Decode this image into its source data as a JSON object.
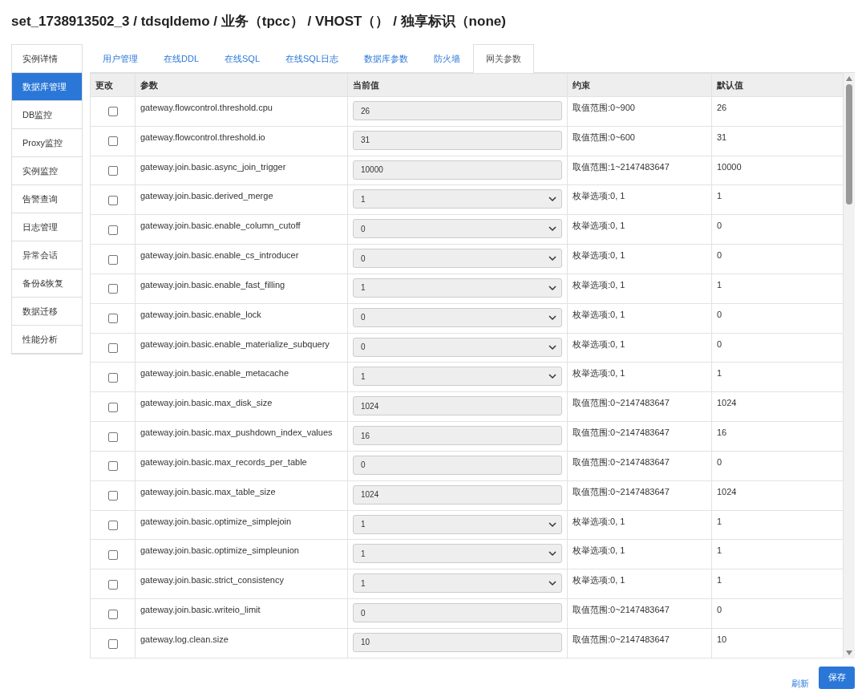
{
  "title": "set_1738913502_3 / tdsqldemo / 业务（tpcc） / VHOST（） / 独享标识（none)",
  "sidebar": [
    {
      "label": "实例详情",
      "selected": false
    },
    {
      "label": "数据库管理",
      "selected": true
    },
    {
      "label": "DB监控",
      "selected": false
    },
    {
      "label": "Proxy监控",
      "selected": false
    },
    {
      "label": "实例监控",
      "selected": false
    },
    {
      "label": "告警查询",
      "selected": false
    },
    {
      "label": "日志管理",
      "selected": false
    },
    {
      "label": "异常会话",
      "selected": false
    },
    {
      "label": "备份&恢复",
      "selected": false
    },
    {
      "label": "数据迁移",
      "selected": false
    },
    {
      "label": "性能分析",
      "selected": false
    }
  ],
  "tabs": [
    {
      "label": "用户管理",
      "selected": false
    },
    {
      "label": "在线DDL",
      "selected": false
    },
    {
      "label": "在线SQL",
      "selected": false
    },
    {
      "label": "在线SQL日志",
      "selected": false
    },
    {
      "label": "数据库参数",
      "selected": false
    },
    {
      "label": "防火墙",
      "selected": false
    },
    {
      "label": "网关参数",
      "selected": true
    }
  ],
  "table": {
    "columns": [
      "更改",
      "参数",
      "当前值",
      "约束",
      "默认值"
    ],
    "rows": [
      {
        "checked": false,
        "param": "gateway.flowcontrol.threshold.cpu",
        "kind": "input",
        "value": "26",
        "constraint": "取值范围:0~900",
        "default": "26"
      },
      {
        "checked": false,
        "param": "gateway.flowcontrol.threshold.io",
        "kind": "input",
        "value": "31",
        "constraint": "取值范围:0~600",
        "default": "31"
      },
      {
        "checked": false,
        "param": "gateway.join.basic.async_join_trigger",
        "kind": "input",
        "value": "10000",
        "constraint": "取值范围:1~2147483647",
        "default": "10000"
      },
      {
        "checked": false,
        "param": "gateway.join.basic.derived_merge",
        "kind": "select",
        "value": "1",
        "constraint": "枚举选项:0, 1",
        "default": "1"
      },
      {
        "checked": false,
        "param": "gateway.join.basic.enable_column_cutoff",
        "kind": "select",
        "value": "0",
        "constraint": "枚举选项:0, 1",
        "default": "0"
      },
      {
        "checked": false,
        "param": "gateway.join.basic.enable_cs_introducer",
        "kind": "select",
        "value": "0",
        "constraint": "枚举选项:0, 1",
        "default": "0"
      },
      {
        "checked": false,
        "param": "gateway.join.basic.enable_fast_filling",
        "kind": "select",
        "value": "1",
        "constraint": "枚举选项:0, 1",
        "default": "1"
      },
      {
        "checked": false,
        "param": "gateway.join.basic.enable_lock",
        "kind": "select",
        "value": "0",
        "constraint": "枚举选项:0, 1",
        "default": "0"
      },
      {
        "checked": false,
        "param": "gateway.join.basic.enable_materialize_subquery",
        "kind": "select",
        "value": "0",
        "constraint": "枚举选项:0, 1",
        "default": "0"
      },
      {
        "checked": false,
        "param": "gateway.join.basic.enable_metacache",
        "kind": "select",
        "value": "1",
        "constraint": "枚举选项:0, 1",
        "default": "1"
      },
      {
        "checked": false,
        "param": "gateway.join.basic.max_disk_size",
        "kind": "input",
        "value": "1024",
        "constraint": "取值范围:0~2147483647",
        "default": "1024"
      },
      {
        "checked": false,
        "param": "gateway.join.basic.max_pushdown_index_values",
        "kind": "input",
        "value": "16",
        "constraint": "取值范围:0~2147483647",
        "default": "16"
      },
      {
        "checked": false,
        "param": "gateway.join.basic.max_records_per_table",
        "kind": "input",
        "value": "0",
        "constraint": "取值范围:0~2147483647",
        "default": "0"
      },
      {
        "checked": false,
        "param": "gateway.join.basic.max_table_size",
        "kind": "input",
        "value": "1024",
        "constraint": "取值范围:0~2147483647",
        "default": "1024"
      },
      {
        "checked": false,
        "param": "gateway.join.basic.optimize_simplejoin",
        "kind": "select",
        "value": "1",
        "constraint": "枚举选项:0, 1",
        "default": "1"
      },
      {
        "checked": false,
        "param": "gateway.join.basic.optimize_simpleunion",
        "kind": "select",
        "value": "1",
        "constraint": "枚举选项:0, 1",
        "default": "1"
      },
      {
        "checked": false,
        "param": "gateway.join.basic.strict_consistency",
        "kind": "select",
        "value": "1",
        "constraint": "枚举选项:0, 1",
        "default": "1"
      },
      {
        "checked": false,
        "param": "gateway.join.basic.writeio_limit",
        "kind": "input",
        "value": "0",
        "constraint": "取值范围:0~2147483647",
        "default": "0"
      },
      {
        "checked": false,
        "param": "gateway.log.clean.size",
        "kind": "input",
        "value": "10",
        "constraint": "取值范围:0~2147483647",
        "default": "10"
      }
    ]
  },
  "footer": {
    "refresh": "刷新",
    "save": "保存"
  }
}
